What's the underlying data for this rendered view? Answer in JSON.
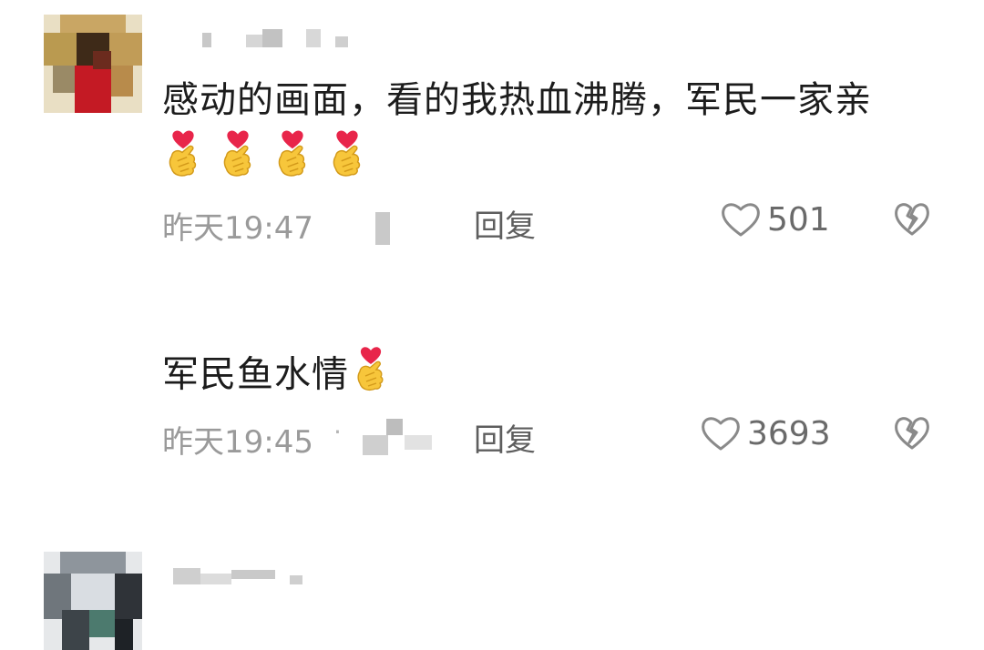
{
  "comments": [
    {
      "text": "感动的画面，看的我热血沸腾，军民一家亲",
      "emoji_count": 4,
      "emoji": "finger-heart-icon",
      "timestamp": "昨天19:47",
      "reply_label": "回复",
      "like_count": "501"
    },
    {
      "text": "军民鱼水情",
      "emoji_count": 1,
      "emoji": "finger-heart-icon",
      "timestamp": "昨天19:45",
      "separator": "·",
      "reply_label": "回复",
      "like_count": "3693"
    }
  ],
  "colors": {
    "text": "#1c1c1c",
    "meta": "#9a9a9a",
    "reply": "#5e5e5e",
    "icon": "#8a8a8a",
    "heart_red": "#e8254a",
    "hand_yellow": "#f7c63b"
  }
}
